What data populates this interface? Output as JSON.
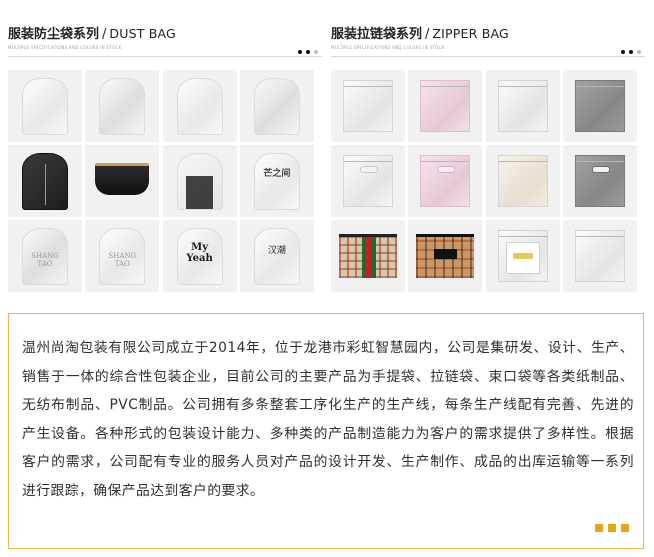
{
  "dust_section": {
    "title_cn": "服装防尘袋系列",
    "separator": "/",
    "title_en": "DUST BAG",
    "subtitle": "MULTIPLE SPECIFICATIONS AND COLORS IN STOCK",
    "items": [
      {
        "name": "clear-dust-bag",
        "print": ""
      },
      {
        "name": "clear-dust-bag",
        "print": ""
      },
      {
        "name": "clear-dust-bag",
        "print": ""
      },
      {
        "name": "clear-dust-bag",
        "print": ""
      },
      {
        "name": "black-garment-bag",
        "print": ""
      },
      {
        "name": "black-zipper-pouch",
        "print": ""
      },
      {
        "name": "garment-cover",
        "print": ""
      },
      {
        "name": "printed-dust-bag",
        "print": "芒之间"
      },
      {
        "name": "printed-dust-bag",
        "print": "SHANG TAO"
      },
      {
        "name": "printed-dust-bag",
        "print": "SHANG TAO"
      },
      {
        "name": "printed-dust-bag",
        "print": "My Yeah"
      },
      {
        "name": "printed-dust-bag",
        "print": "汉潮"
      }
    ]
  },
  "zipper_section": {
    "title_cn": "服装拉链袋系列",
    "separator": "/",
    "title_en": "ZIPPER BAG",
    "subtitle": "MULTIPLE SPECIFICATIONS AND COLORS IN STOCK"
  },
  "description": "温州尚淘包装有限公司成立于2014年，位于龙港市彩虹智慧园内，公司是集研发、设计、生产、销售于一体的综合性包装企业，目前公司的主要产品为手提袋、拉链袋、束口袋等各类纸制品、无纺布制品、PVC制品。公司拥有多条整套工序化生产的生产线，每条生产线配有完善、先进的产生设备。各种形式的包装设计能力、多种类的产品制造能力为客户的需求提供了多样性。根据客户的需求，公司配有专业的服务人员对产品的设计开发、生产制作、成品的出库运输等一系列进行跟踪，确保产品达到客户的要求。",
  "colors": {
    "accent": "#e8a512",
    "border": "#e8b84a",
    "cell_bg": "#f1f1f1"
  }
}
